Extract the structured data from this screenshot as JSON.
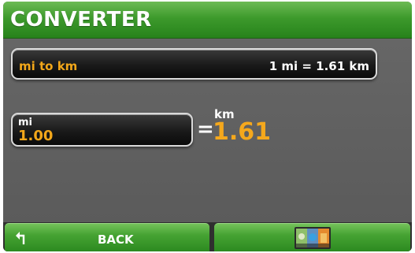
{
  "header": {
    "title": "CONVERTER"
  },
  "converter": {
    "conversion_name": "mi to km",
    "conversion_rate": "1 mi = 1.61 km",
    "input_unit": "mi",
    "input_value": "1.00",
    "equals": "=",
    "result_unit": "km",
    "result_value": "1.61"
  },
  "footer": {
    "back_label": "BACK",
    "back_icon": "back-arrow-icon",
    "map_icon": "map-icon"
  },
  "colors": {
    "accent_green": "#3d9a2c",
    "value_orange": "#f2a71a",
    "background_gray": "#5d5d5d"
  }
}
